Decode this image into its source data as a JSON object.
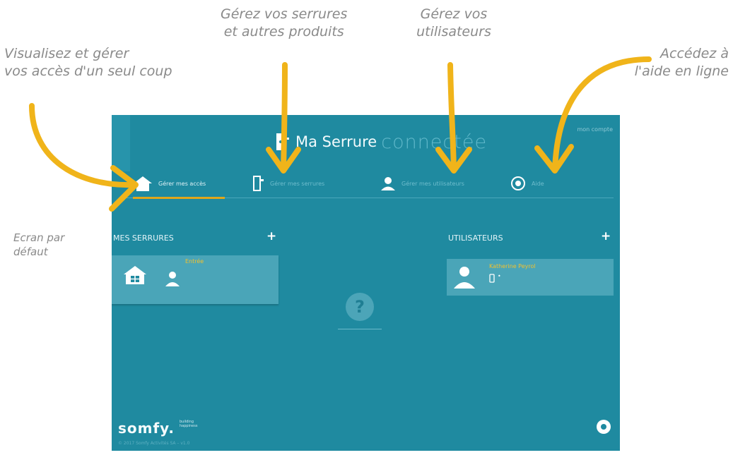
{
  "annotations": {
    "access": [
      "Visualisez et gérer",
      "vos accès d'un seul coup"
    ],
    "locks": [
      "Gérez vos serrures",
      "et autres produits"
    ],
    "users": [
      "Gérez vos",
      "utilisateurs"
    ],
    "help": [
      "Accédez à",
      "l'aide en ligne"
    ],
    "default_screen": [
      "Ecran par",
      "défaut"
    ]
  },
  "app": {
    "brand_name": "Ma Serrure",
    "brand_suffix": "connectée",
    "top_right": "mon compte",
    "tabs": [
      {
        "label": "Gérer mes accès",
        "icon": "house-icon",
        "active": true
      },
      {
        "label": "Gérer mes serrures",
        "icon": "lock-key-icon",
        "active": false
      },
      {
        "label": "Gérer mes utilisateurs",
        "icon": "user-icon",
        "active": false
      },
      {
        "label": "Aide",
        "icon": "help-icon",
        "active": false
      }
    ],
    "locks_section": {
      "title": "MES SERRURES",
      "add": "+",
      "card_name": "Entrée"
    },
    "users_section": {
      "title": "UTILISATEURS",
      "add": "+",
      "user_name": "Katherine Peyrol",
      "device_suffix": "•"
    },
    "help_button": "?",
    "footer": {
      "logo": "somfy.",
      "tagline": [
        "building",
        "happiness"
      ],
      "copyright": "© 2017 Somfy Activités SA – v1.0"
    }
  },
  "colors": {
    "app_bg": "#1f8aa0",
    "card_bg": "#4aa5b8",
    "accent": "#e0a71b",
    "annotation_text": "#8a8a8a",
    "arrow": "#f0b41a"
  }
}
